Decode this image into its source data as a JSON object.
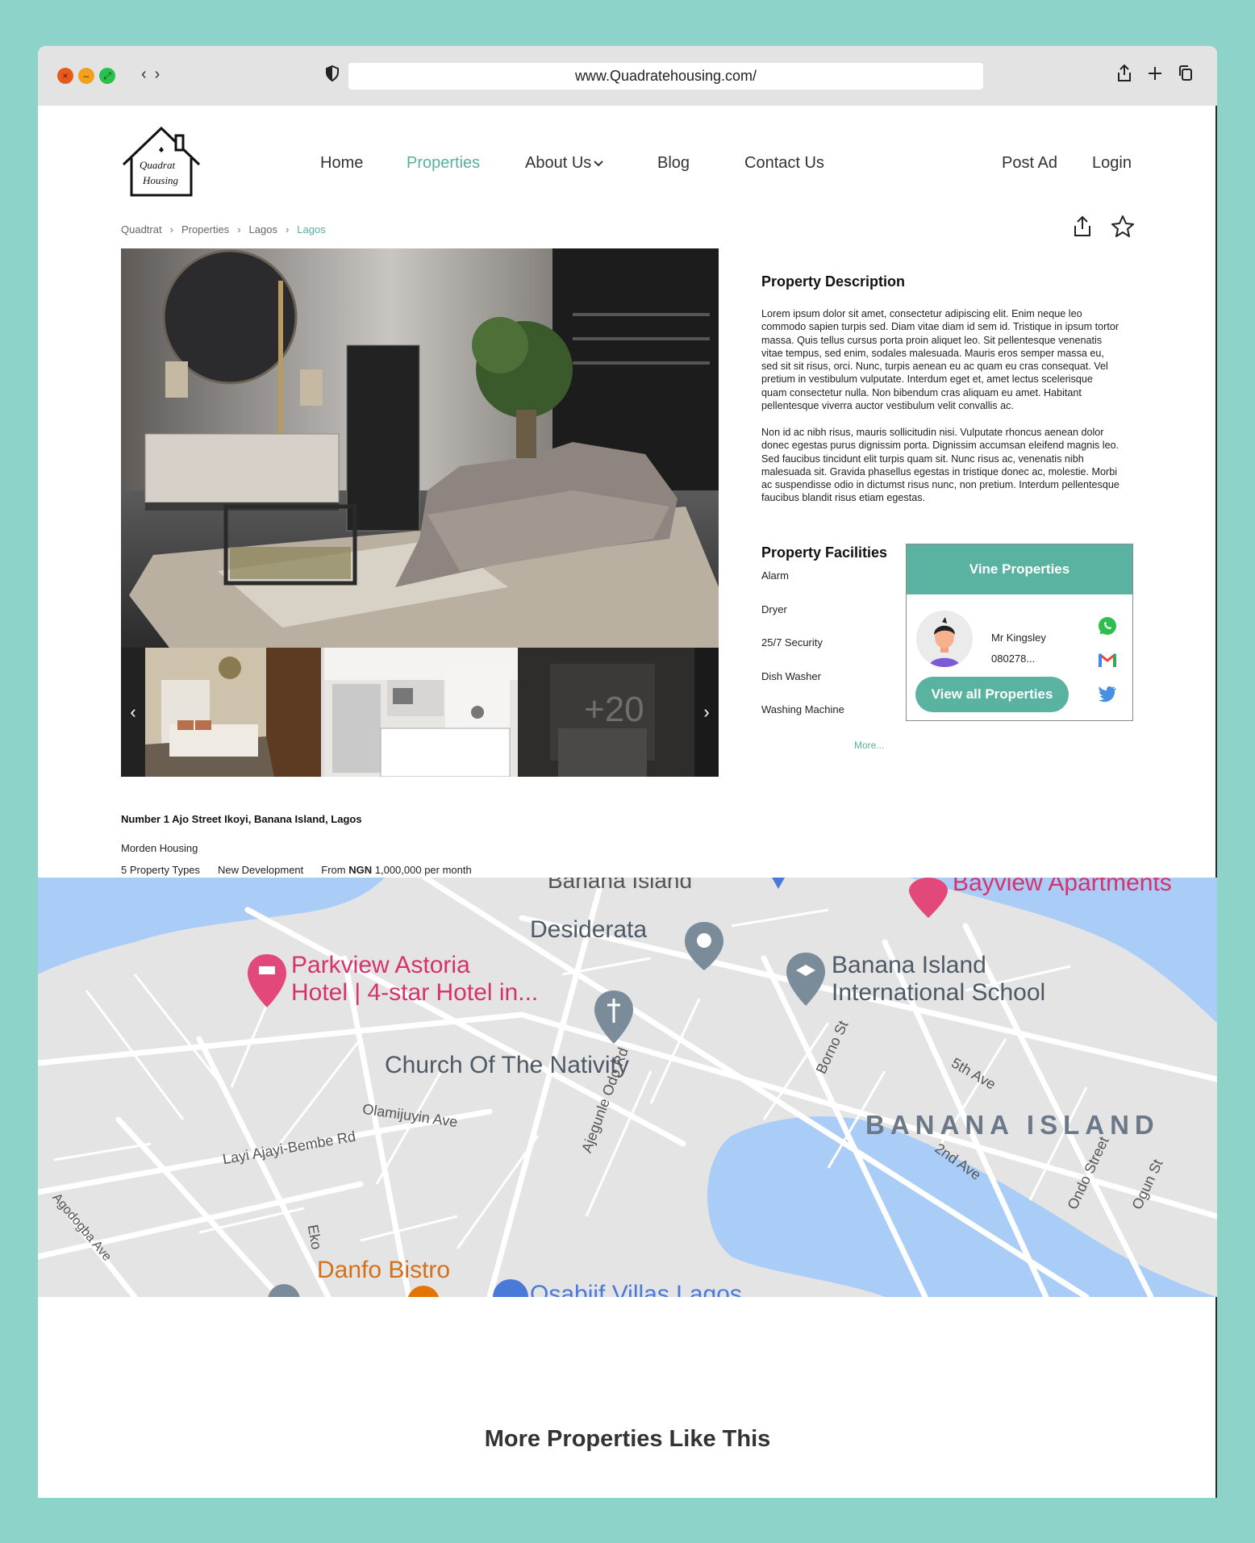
{
  "browser": {
    "url": "www.Quadratehousing.com/"
  },
  "brand": {
    "name_line1": "Quadrat",
    "name_line2": "Housing",
    "accent_color": "#58b09f"
  },
  "nav": {
    "home": "Home",
    "properties": "Properties",
    "about": "About Us",
    "blog": "Blog",
    "contact": "Contact Us",
    "post_ad": "Post Ad",
    "login": "Login"
  },
  "breadcrumb": [
    "Quadtrat",
    "Properties",
    "Lagos",
    "Lagos"
  ],
  "gallery": {
    "more_count": "+20"
  },
  "description": {
    "title": "Property Description",
    "p1": "Lorem ipsum dolor sit amet, consectetur adipiscing elit. Enim neque leo commodo sapien turpis sed. Diam vitae diam id sem id. Tristique in ipsum tortor massa. Quis tellus cursus porta proin aliquet leo. Sit pellentesque venenatis vitae tempus, sed enim, sodales malesuada. Mauris eros semper massa eu, sed sit sit risus, orci. Nunc, turpis aenean eu ac quam eu cras consequat. Vel pretium in vestibulum vulputate. Interdum eget et, amet lectus scelerisque quam consectetur nulla. Non bibendum cras aliquam eu amet. Habitant pellentesque viverra auctor vestibulum velit convallis ac.",
    "p2": "Non id ac nibh risus, mauris sollicitudin nisi. Vulputate rhoncus aenean dolor donec egestas purus dignissim porta. Dignissim accumsan eleifend magnis leo. Sed faucibus tincidunt elit turpis quam sit. Nunc risus ac, venenatis nibh malesuada sit. Gravida phasellus egestas in tristique donec ac, molestie. Morbi ac suspendisse odio in dictumst risus nunc, non pretium. Interdum pellentesque faucibus blandit risus etiam egestas."
  },
  "facilities": {
    "title": "Property Facilities",
    "items": [
      "Alarm",
      "Dryer",
      "25/7 Security",
      "Dish Washer",
      "Washing Machine"
    ],
    "more": "More..."
  },
  "agent": {
    "company": "Vine Properties",
    "name": "Mr Kingsley",
    "phone": "080278...",
    "button": "View all Properties"
  },
  "listing": {
    "address": "Number 1 Ajo Street Ikoyi, Banana Island, Lagos",
    "subtitle": "Morden Housing",
    "types": "5 Property Types",
    "status": "New Development",
    "price_prefix": "From",
    "currency": "NGN",
    "price": "1,000,000 per month"
  },
  "map": {
    "labels": {
      "banana_top": "Banana Island",
      "bayview": "Bayview Apartments",
      "desiderata": "Desiderata",
      "parkview1": "Parkview Astoria",
      "parkview2": "Hotel | 4-star Hotel in...",
      "school1": "Banana Island",
      "school2": "International School",
      "church": "Church Of The Nativity",
      "bornost": "Borno St",
      "fifth": "5th Ave",
      "banana_big": "BANANA ISLAND",
      "olamijuyin": "Olamijuyin Ave",
      "layi": "Layi Ajayi-Bembe Rd",
      "ajegunle": "Ajegunle Odo Rd",
      "second": "2nd Ave",
      "ondo": "Ondo Street",
      "ogun": "Ogun St",
      "eko": "Eko",
      "agodogba": "Agodogba Ave",
      "danfo": "Danfo Bistro",
      "osabiif": "Osabiif Villas Lagos"
    }
  },
  "more_section": {
    "title": "More Properties Like This"
  }
}
